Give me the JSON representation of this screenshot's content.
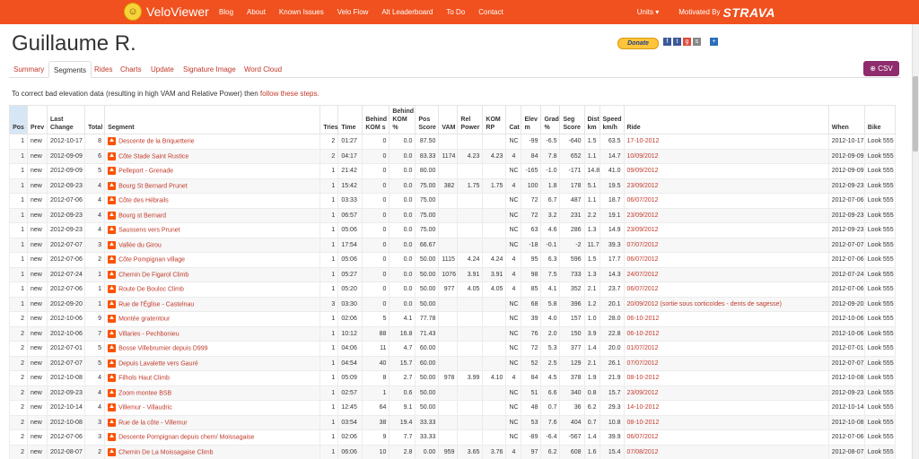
{
  "nav": {
    "brand": "VeloViewer",
    "links": [
      "Blog",
      "About",
      "Known Issues",
      "Velo Flow",
      "Alt Leaderboard",
      "To Do",
      "Contact"
    ],
    "units": "Units",
    "motivated": "Motivated By",
    "strava": "STRAVA"
  },
  "athlete": {
    "name": "Guillaume R."
  },
  "donate_label": "Donate",
  "tabs": [
    "Summary",
    "Segments",
    "Rides",
    "Charts",
    "Update",
    "Signature Image",
    "Word Cloud"
  ],
  "active_tab": "Segments",
  "csv_label": "CSV",
  "notice": {
    "text": "To correct bad elevation data (resulting in high VAM and Relative Power) then ",
    "link": "follow these steps."
  },
  "columns": [
    "Pos",
    "Prev",
    "Last Change",
    "Total",
    "Segment",
    "Tries",
    "Time",
    "Behind KOM s",
    "Behind KOM %",
    "Pos Score",
    "VAM",
    "Rel Power",
    "KOM RP",
    "Cat",
    "Elev m",
    "Grad %",
    "Seg Score",
    "Dist km",
    "Speed km/h",
    "Ride",
    "When",
    "Bike"
  ],
  "rows": [
    [
      "1",
      "new",
      "2012-10-17",
      "8",
      "Descente de la Briquetterie",
      "2",
      "01:27",
      "0",
      "0.0",
      "87.50",
      "",
      "",
      "",
      "NC",
      "-99",
      "-6.5",
      "-640",
      "1.5",
      "63.5",
      "17-10-2012",
      "2012-10-17",
      "Look 555"
    ],
    [
      "1",
      "new",
      "2012-09-09",
      "6",
      "Côte Stade Saint Rustice",
      "2",
      "04:17",
      "0",
      "0.0",
      "83.33",
      "1174",
      "4.23",
      "4.23",
      "4",
      "84",
      "7.8",
      "652",
      "1.1",
      "14.7",
      "10/09/2012",
      "2012-09-09",
      "Look 555"
    ],
    [
      "1",
      "new",
      "2012-09-09",
      "5",
      "Pelleport - Grenade",
      "1",
      "21:42",
      "0",
      "0.0",
      "80.00",
      "",
      "",
      "",
      "NC",
      "-165",
      "-1.0",
      "-171",
      "14.8",
      "41.0",
      "09/09/2012",
      "2012-09-09",
      "Look 555"
    ],
    [
      "1",
      "new",
      "2012-09-23",
      "4",
      "Bourg St Bernard Prunet",
      "1",
      "15:42",
      "0",
      "0.0",
      "75.00",
      "382",
      "1.75",
      "1.75",
      "4",
      "100",
      "1.8",
      "178",
      "5.1",
      "19.5",
      "23/09/2012",
      "2012-09-23",
      "Look 555"
    ],
    [
      "1",
      "new",
      "2012-07-06",
      "4",
      "Côte des Hébrails",
      "1",
      "03:33",
      "0",
      "0.0",
      "75.00",
      "",
      "",
      "",
      "NC",
      "72",
      "6.7",
      "487",
      "1.1",
      "18.7",
      "06/07/2012",
      "2012-07-06",
      "Look 555"
    ],
    [
      "1",
      "new",
      "2012-09-23",
      "4",
      "Bourg st Bernard",
      "1",
      "06:57",
      "0",
      "0.0",
      "75.00",
      "",
      "",
      "",
      "NC",
      "72",
      "3.2",
      "231",
      "2.2",
      "19.1",
      "23/09/2012",
      "2012-09-23",
      "Look 555"
    ],
    [
      "1",
      "new",
      "2012-09-23",
      "4",
      "Saussens vers Prunet",
      "1",
      "05:06",
      "0",
      "0.0",
      "75.00",
      "",
      "",
      "",
      "NC",
      "63",
      "4.6",
      "286",
      "1.3",
      "14.9",
      "23/09/2012",
      "2012-09-23",
      "Look 555"
    ],
    [
      "1",
      "new",
      "2012-07-07",
      "3",
      "Vallée du Girou",
      "1",
      "17:54",
      "0",
      "0.0",
      "66.67",
      "",
      "",
      "",
      "NC",
      "-18",
      "-0.1",
      "-2",
      "11.7",
      "39.3",
      "07/07/2012",
      "2012-07-07",
      "Look 555"
    ],
    [
      "1",
      "new",
      "2012-07-06",
      "2",
      "Côte Pompignan village",
      "1",
      "05:06",
      "0",
      "0.0",
      "50.00",
      "1115",
      "4.24",
      "4.24",
      "4",
      "95",
      "6.3",
      "596",
      "1.5",
      "17.7",
      "06/07/2012",
      "2012-07-06",
      "Look 555"
    ],
    [
      "1",
      "new",
      "2012-07-24",
      "1",
      "Chemin De Figarol Climb",
      "1",
      "05:27",
      "0",
      "0.0",
      "50.00",
      "1076",
      "3.91",
      "3.91",
      "4",
      "98",
      "7.5",
      "733",
      "1.3",
      "14.3",
      "24/07/2012",
      "2012-07-24",
      "Look 555"
    ],
    [
      "1",
      "new",
      "2012-07-06",
      "1",
      "Route De Bouloc Climb",
      "1",
      "05:20",
      "0",
      "0.0",
      "50.00",
      "977",
      "4.05",
      "4.05",
      "4",
      "85",
      "4.1",
      "352",
      "2.1",
      "23.7",
      "06/07/2012",
      "2012-07-06",
      "Look 555"
    ],
    [
      "1",
      "new",
      "2012-09-20",
      "1",
      "Rue de l'Église - Castelnau",
      "3",
      "03:30",
      "0",
      "0.0",
      "50.00",
      "",
      "",
      "",
      "NC",
      "68",
      "5.8",
      "396",
      "1.2",
      "20.1",
      "20/09/2012 (sortie sous corticoïdes - dents de sagesse)",
      "2012-09-20",
      "Look 555"
    ],
    [
      "2",
      "new",
      "2012-10-06",
      "9",
      "Montée gratentour",
      "1",
      "02:06",
      "5",
      "4.1",
      "77.78",
      "",
      "",
      "",
      "NC",
      "39",
      "4.0",
      "157",
      "1.0",
      "28.0",
      "06-10-2012",
      "2012-10-06",
      "Look 555"
    ],
    [
      "2",
      "new",
      "2012-10-06",
      "7",
      "Villaries - Pechbonieu",
      "1",
      "10:12",
      "88",
      "16.8",
      "71.43",
      "",
      "",
      "",
      "NC",
      "76",
      "2.0",
      "150",
      "3.9",
      "22.8",
      "06-10-2012",
      "2012-10-06",
      "Look 555"
    ],
    [
      "2",
      "new",
      "2012-07-01",
      "5",
      "Bosse Villebrumier depuis D999",
      "1",
      "04:06",
      "11",
      "4.7",
      "60.00",
      "",
      "",
      "",
      "NC",
      "72",
      "5.3",
      "377",
      "1.4",
      "20.0",
      "01/07/2012",
      "2012-07-01",
      "Look 555"
    ],
    [
      "2",
      "new",
      "2012-07-07",
      "5",
      "Depuis Lavalette vers Gauré",
      "1",
      "04:54",
      "40",
      "15.7",
      "60.00",
      "",
      "",
      "",
      "NC",
      "52",
      "2.5",
      "129",
      "2.1",
      "26.1",
      "07/07/2012",
      "2012-07-07",
      "Look 555"
    ],
    [
      "2",
      "new",
      "2012-10-08",
      "4",
      "Filhols Haut Climb",
      "1",
      "05:09",
      "8",
      "2.7",
      "50.00",
      "978",
      "3.99",
      "4.10",
      "4",
      "84",
      "4.5",
      "378",
      "1.9",
      "21.9",
      "08-10-2012",
      "2012-10-08",
      "Look 555"
    ],
    [
      "2",
      "new",
      "2012-09-23",
      "4",
      "Zoom montee BSB",
      "1",
      "02:57",
      "1",
      "0.6",
      "50.00",
      "",
      "",
      "",
      "NC",
      "51",
      "6.6",
      "340",
      "0.8",
      "15.7",
      "23/09/2012",
      "2012-09-23",
      "Look 555"
    ],
    [
      "2",
      "new",
      "2012-10-14",
      "4",
      "Villemur - Villaudric",
      "1",
      "12:45",
      "64",
      "9.1",
      "50.00",
      "",
      "",
      "",
      "NC",
      "48",
      "0.7",
      "36",
      "6.2",
      "29.3",
      "14-10-2012",
      "2012-10-14",
      "Look 555"
    ],
    [
      "2",
      "new",
      "2012-10-08",
      "3",
      "Rue de la côte - Villemur",
      "1",
      "03:54",
      "38",
      "19.4",
      "33.33",
      "",
      "",
      "",
      "NC",
      "53",
      "7.6",
      "404",
      "0.7",
      "10.8",
      "08-10-2012",
      "2012-10-08",
      "Look 555"
    ],
    [
      "2",
      "new",
      "2012-07-06",
      "3",
      "Descente Pompignan depuis chem/ Moissagaise",
      "1",
      "02:06",
      "9",
      "7.7",
      "33.33",
      "",
      "",
      "",
      "NC",
      "-89",
      "-6.4",
      "-567",
      "1.4",
      "39.9",
      "06/07/2012",
      "2012-07-06",
      "Look 555"
    ],
    [
      "2",
      "new",
      "2012-08-07",
      "2",
      "Chemin De La Moissagaise Climb",
      "1",
      "06:06",
      "10",
      "2.8",
      "0.00",
      "959",
      "3.65",
      "3.76",
      "4",
      "97",
      "6.2",
      "608",
      "1.6",
      "15.4",
      "07/08/2012",
      "2012-08-07",
      "Look 555"
    ]
  ]
}
